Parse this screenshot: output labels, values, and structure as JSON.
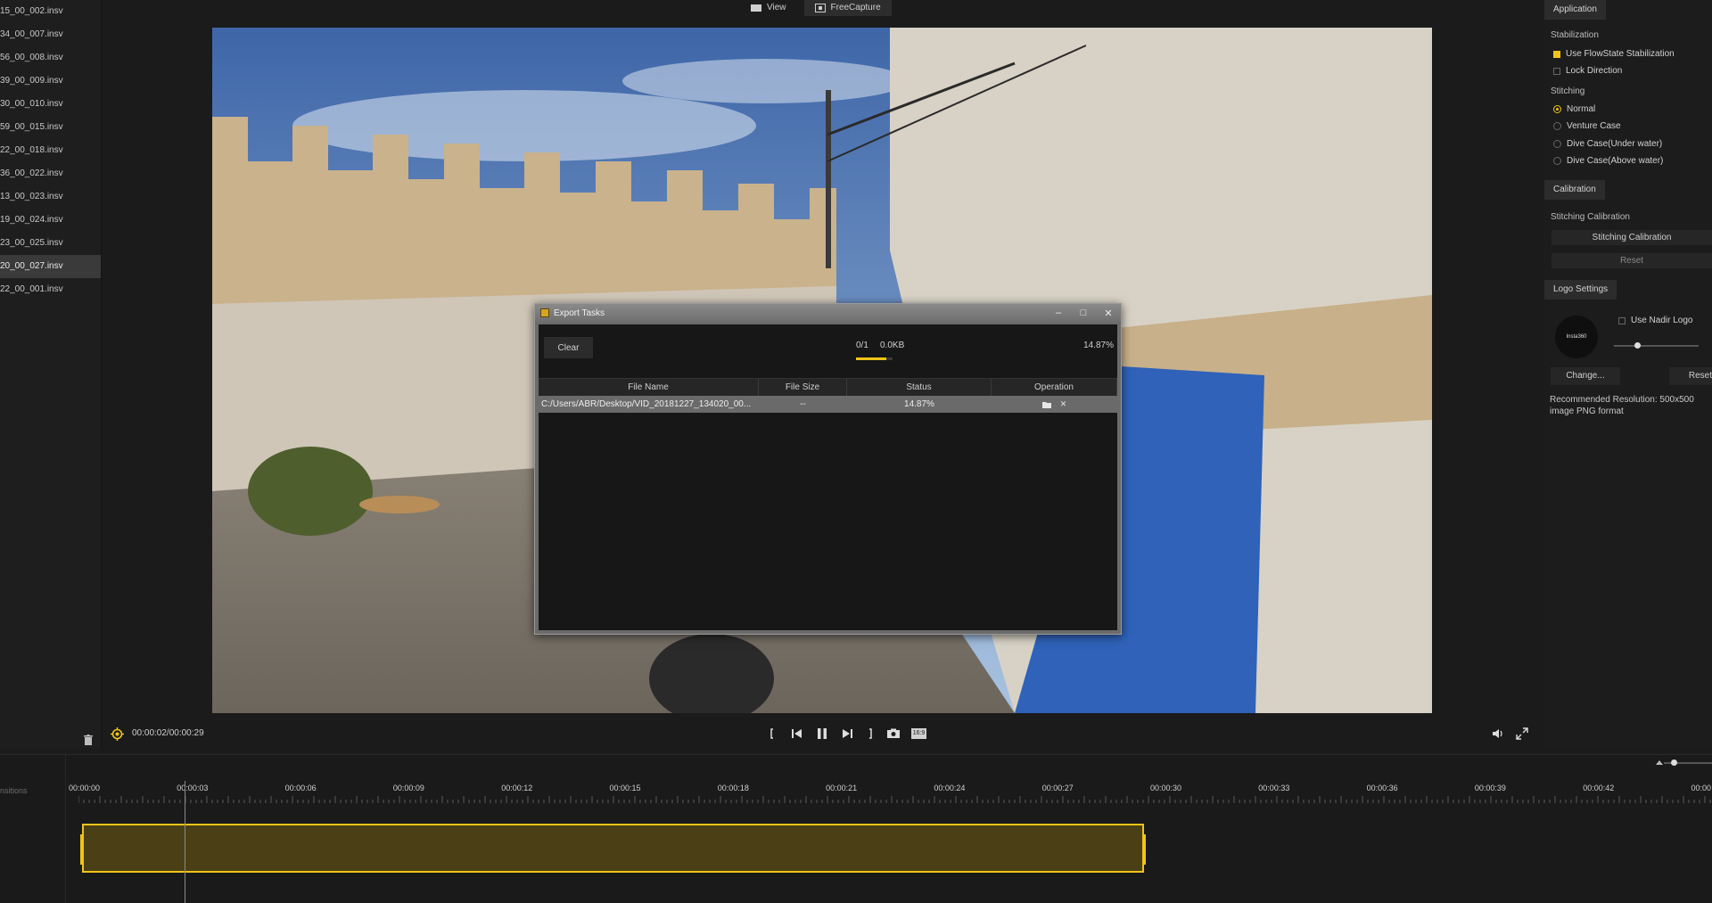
{
  "file_list": {
    "items": [
      "15_00_002.insv",
      "34_00_007.insv",
      "56_00_008.insv",
      "39_00_009.insv",
      "30_00_010.insv",
      "59_00_015.insv",
      "22_00_018.insv",
      "36_00_022.insv",
      "13_00_023.insv",
      "19_00_024.insv",
      "23_00_025.insv",
      "20_00_027.insv",
      "22_00_001.insv"
    ],
    "selected_index": 11
  },
  "top_tabs": {
    "view": "View",
    "freecapture": "FreeCapture"
  },
  "export_dialog": {
    "title": "Export Tasks",
    "clear_label": "Clear",
    "progress_count": "0/1",
    "progress_size": "0.0KB",
    "progress_percent": "14.87%",
    "progress_fraction": 0.1487,
    "columns": [
      "File Name",
      "File Size",
      "Status",
      "Operation"
    ],
    "rows": [
      {
        "file_name": "C:/Users/ABR/Desktop/VID_20181227_134020_00...",
        "file_size": "--",
        "status": "14.87%"
      }
    ]
  },
  "right_panel": {
    "application_tab": "Application",
    "stabilization_label": "Stabilization",
    "use_flowstate": "Use FlowState Stabilization",
    "lock_direction": "Lock Direction",
    "stitching_label": "Stitching",
    "stitching_options": [
      "Normal",
      "Venture Case",
      "Dive Case(Under water)",
      "Dive Case(Above water)"
    ],
    "calibration_tab": "Calibration",
    "stitching_calibration_label": "Stitching Calibration",
    "stitching_calibration_button": "Stitching Calibration",
    "reset_button": "Reset",
    "logo_settings_tab": "Logo Settings",
    "use_nadir_logo": "Use Nadir Logo",
    "logo_thumb_text": "Insta360",
    "change_button": "Change...",
    "logo_reset_button": "Reset",
    "recommended_text": "Recommended Resolution: 500x500 image PNG format"
  },
  "playback": {
    "time": "00:00:02/00:00:29",
    "aspect_badge": "16:9"
  },
  "timeline": {
    "transitions_label": "nsitions",
    "ticks": [
      "00:00:00",
      "00:00:03",
      "00:00:06",
      "00:00:09",
      "00:00:12",
      "00:00:15",
      "00:00:18",
      "00:00:21",
      "00:00:24",
      "00:00:27",
      "00:00:30",
      "00:00:33",
      "00:00:36",
      "00:00:39",
      "00:00:42",
      "00:00"
    ]
  },
  "colors": {
    "accent": "#f0c419",
    "background": "#1b1b1b",
    "panel": "#2c2c2c"
  }
}
